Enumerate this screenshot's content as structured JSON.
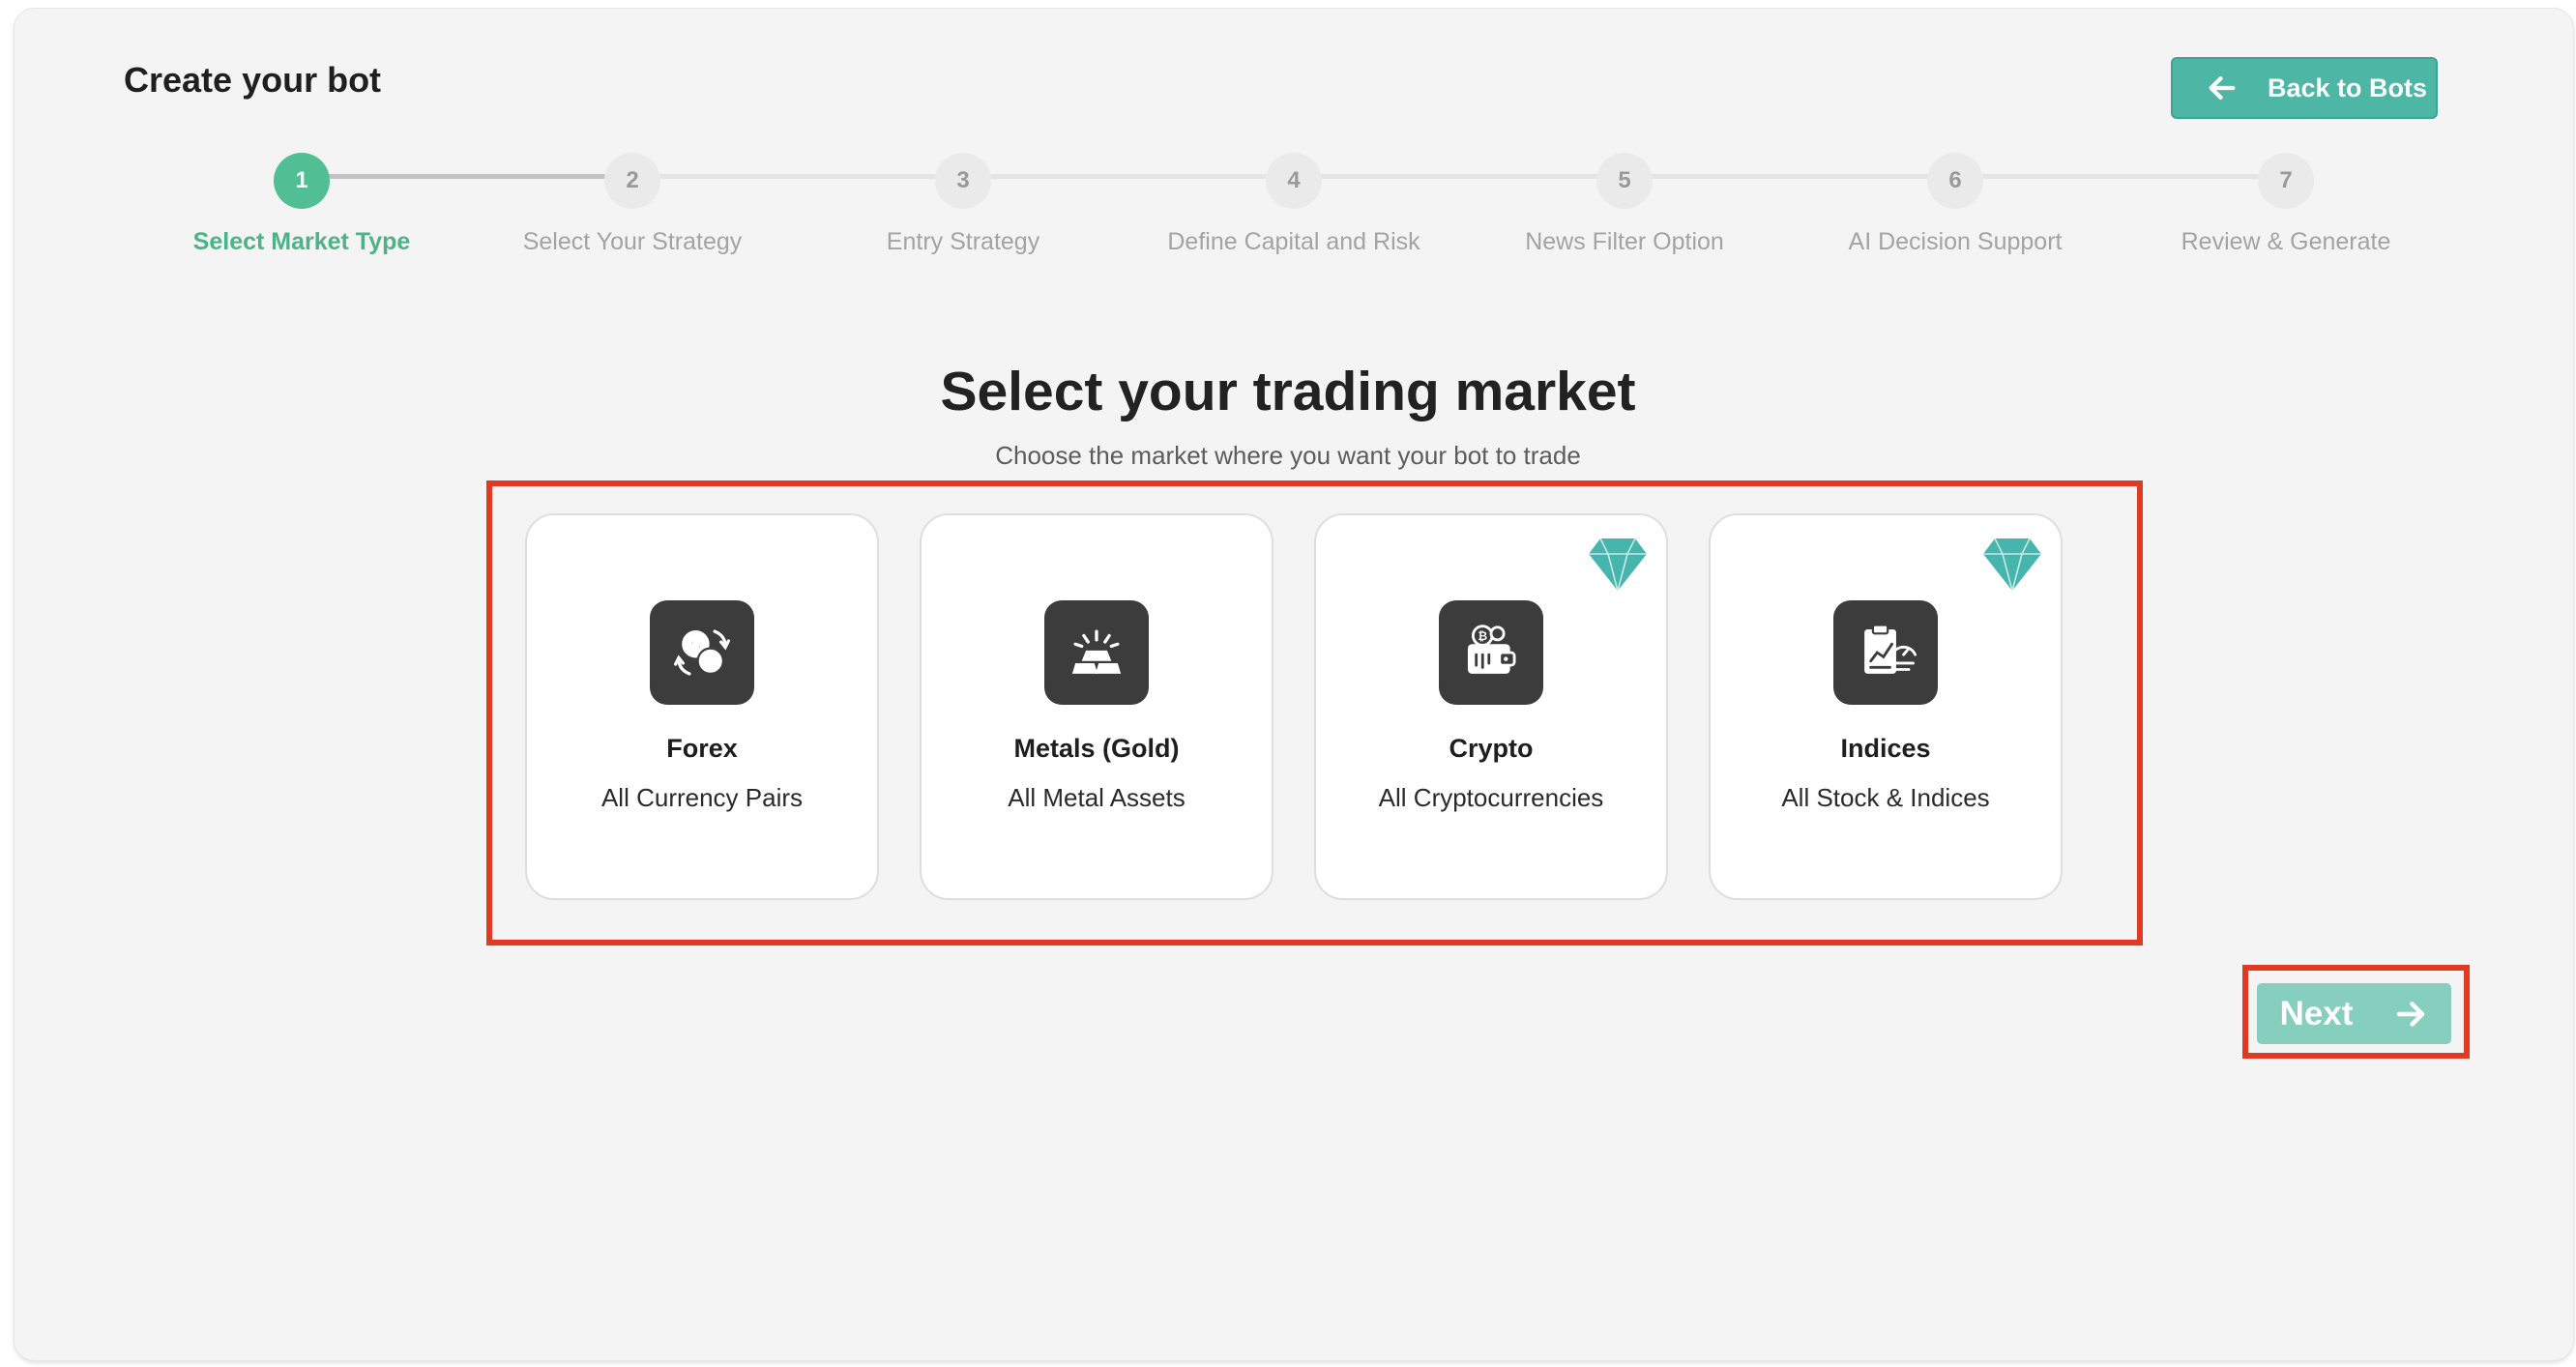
{
  "header": {
    "title": "Create your bot",
    "back_label": "Back to Bots"
  },
  "stepper": {
    "active_step": 1,
    "steps": [
      {
        "number": "1",
        "label": "Select Market Type"
      },
      {
        "number": "2",
        "label": "Select Your Strategy"
      },
      {
        "number": "3",
        "label": "Entry Strategy"
      },
      {
        "number": "4",
        "label": "Define Capital and Risk"
      },
      {
        "number": "5",
        "label": "News Filter Option"
      },
      {
        "number": "6",
        "label": "AI Decision Support"
      },
      {
        "number": "7",
        "label": "Review & Generate"
      }
    ]
  },
  "main": {
    "title": "Select your trading market",
    "subtitle": "Choose the market where you want your bot to trade",
    "markets": [
      {
        "title": "Forex",
        "subtitle": "All Currency Pairs",
        "icon": "currency-exchange-icon",
        "premium": false
      },
      {
        "title": "Metals (Gold)",
        "subtitle": "All Metal Assets",
        "icon": "gold-bars-icon",
        "premium": false
      },
      {
        "title": "Crypto",
        "subtitle": "All Cryptocurrencies",
        "icon": "crypto-wallet-icon",
        "premium": true
      },
      {
        "title": "Indices",
        "subtitle": "All Stock & Indices",
        "icon": "stock-report-icon",
        "premium": true
      }
    ]
  },
  "footer": {
    "next_label": "Next"
  },
  "colors": {
    "accent": "#52be94",
    "button": "#4db6a4",
    "next_disabled": "#86cfbf",
    "premium": "#45b5ad",
    "highlight": "#e03a22"
  }
}
